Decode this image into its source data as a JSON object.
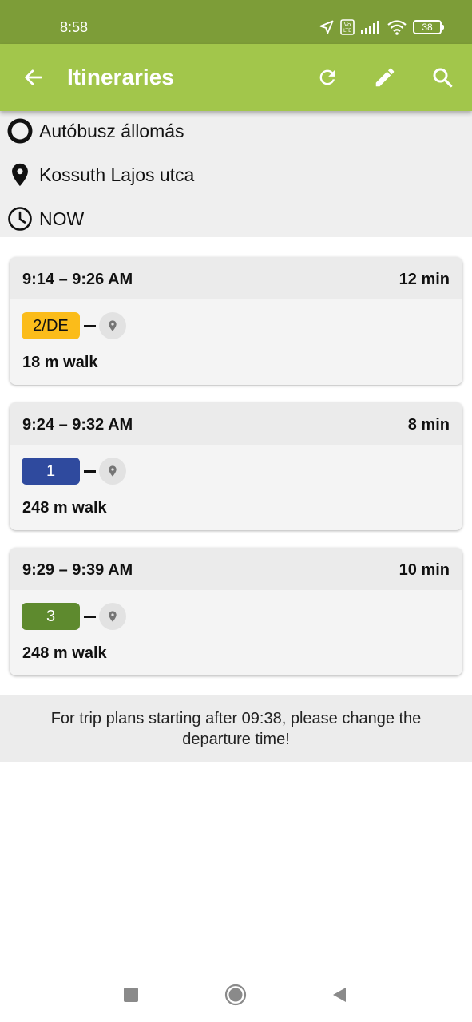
{
  "status_bar": {
    "time": "8:58",
    "battery": "38",
    "icons": [
      "navigation-icon",
      "volte-icon",
      "signal-icon",
      "wifi-icon",
      "battery-icon"
    ]
  },
  "app_bar": {
    "title": "Itineraries",
    "background": "#a2c64b",
    "icons": [
      "back-arrow-icon",
      "refresh-icon",
      "edit-icon",
      "search-icon"
    ]
  },
  "route": {
    "from": "Autóbusz állomás",
    "to": "Kossuth Lajos utca",
    "when": "NOW"
  },
  "itineraries": [
    {
      "time": "9:14 – 9:26 AM",
      "duration": "12 min",
      "line": "2/DE",
      "line_color": "#fbbc1a",
      "line_text_color": "#111111",
      "walk": "18 m walk"
    },
    {
      "time": "9:24 – 9:32 AM",
      "duration": "8 min",
      "line": "1",
      "line_color": "#2f4a9e",
      "line_text_color": "#ffffff",
      "walk": "248 m walk"
    },
    {
      "time": "9:29 – 9:39 AM",
      "duration": "10 min",
      "line": "3",
      "line_color": "#5e8a2e",
      "line_text_color": "#ffffff",
      "walk": "248 m walk"
    }
  ],
  "notice": "For trip plans starting after 09:38, please change the departure time!",
  "nav_bar": {
    "icons": [
      "recents-icon",
      "home-icon",
      "back-icon"
    ]
  }
}
